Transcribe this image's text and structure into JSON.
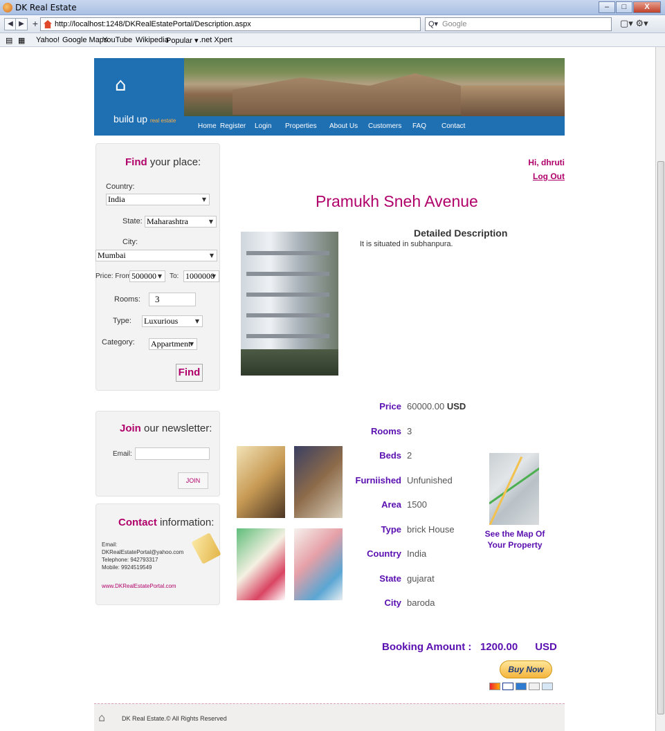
{
  "browser": {
    "window_title": "DK Real Estate",
    "url": "http://localhost:1248/DKRealEstatePortal/Description.aspx",
    "search_placeholder": "Google",
    "bookmarks": [
      "Yahoo!",
      "Google Maps",
      "YouTube",
      "Wikipedia",
      "Popular ▾",
      ".net Xpert"
    ]
  },
  "site": {
    "logo_text": "build up",
    "logo_sub": "real estate",
    "menu": [
      "Home",
      "Register",
      "Login",
      "Properties",
      "About Us",
      "Customers",
      "FAQ",
      "Contact"
    ]
  },
  "find": {
    "title_accent": "Find",
    "title_rest": " your place:",
    "country_label": "Country:",
    "country_value": "India",
    "state_label": "State:",
    "state_value": "Maharashtra",
    "city_label": "City:",
    "city_value": "Mumbai",
    "price_label": "Price:",
    "from_label": "From:",
    "price_from": "500000",
    "to_label": "To:",
    "price_to": "1000000",
    "rooms_label": "Rooms:",
    "rooms_value": "3",
    "type_label": "Type:",
    "type_value": "Luxurious",
    "category_label": "Category:",
    "category_value": "Appartment",
    "button": "Find"
  },
  "newsletter": {
    "title_accent": "Join",
    "title_rest": " our newsletter:",
    "email_label": "Email:",
    "button": "JOIN"
  },
  "contact": {
    "title_accent": "Contact",
    "title_rest": " information:",
    "email_label": "Email:",
    "email": "DKRealEstatePortal@yahoo.com",
    "telephone": "Telephone: 942793317",
    "mobile": "Mobile: 9924519549",
    "website": "www.DKRealEstatePortal.com"
  },
  "user": {
    "greeting": "Hi, dhruti",
    "logout": "Log Out"
  },
  "property": {
    "title": "Pramukh Sneh Avenue",
    "desc_heading": "Detailed Description",
    "desc_text": "It is situated in subhanpura.",
    "details": [
      {
        "key": "Price",
        "value": "60000.00",
        "suffix": "USD"
      },
      {
        "key": "Rooms",
        "value": "3"
      },
      {
        "key": "Beds",
        "value": "2"
      },
      {
        "key": "Furniished",
        "value": "Unfunished"
      },
      {
        "key": "Area",
        "value": "1500"
      },
      {
        "key": "Type",
        "value": "brick House"
      },
      {
        "key": "Country",
        "value": "India"
      },
      {
        "key": "State",
        "value": "gujarat"
      },
      {
        "key": "City",
        "value": "baroda"
      }
    ],
    "map_caption": "See the Map Of Your Property",
    "booking_label": "Booking Amount :",
    "booking_amount": "1200.00",
    "booking_currency": "USD",
    "buy_now": "Buy Now"
  },
  "footer": {
    "text": "DK Real Estate.© All Rights Reserved"
  },
  "colors": {
    "accent": "#b0006a",
    "detail_key": "#5a0fb0",
    "header_blue": "#1f6fb3"
  }
}
